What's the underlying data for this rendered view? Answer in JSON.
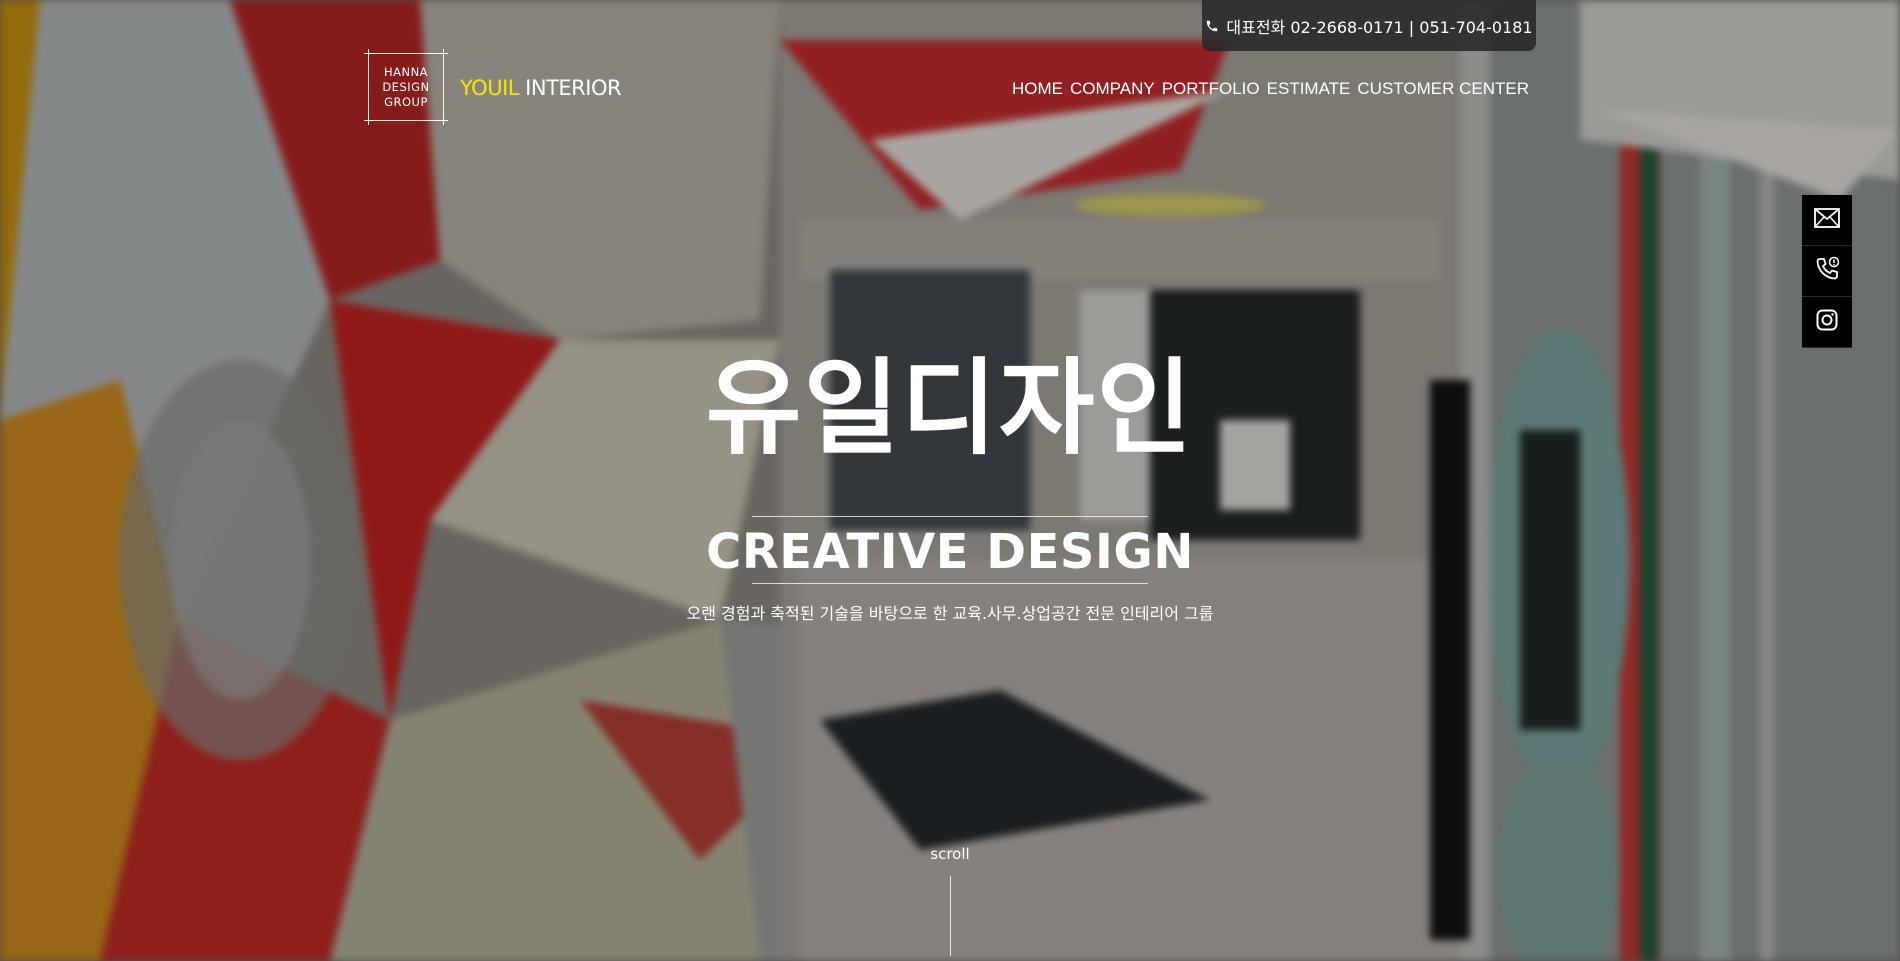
{
  "top_bar": {
    "phone_text": "대표전화 02-2668-0171 | 051-704-0181",
    "phone_icon": "phone-icon"
  },
  "logo": {
    "line1": "HANNA",
    "line2": "DESIGN",
    "line3": "GROUP",
    "brand_highlight": "YOUIL",
    "brand_rest": "INTERIOR",
    "highlight_color": "#f7e600"
  },
  "nav": {
    "items": [
      "HOME",
      "COMPANY",
      "PORTFOLIO",
      "ESTIMATE",
      "CUSTOMER CENTER"
    ]
  },
  "quick_bar": {
    "icons": [
      "mail-icon",
      "phone-call-icon",
      "instagram-icon"
    ]
  },
  "hero": {
    "title": "유일디자인",
    "subtitle": "CREATIVE DESIGN",
    "tagline": "오랜 경험과 축적된 기술을 바탕으로 한 교육.사무.상업공간 전문 인테리어 그룹",
    "scroll_label": "scroll"
  }
}
